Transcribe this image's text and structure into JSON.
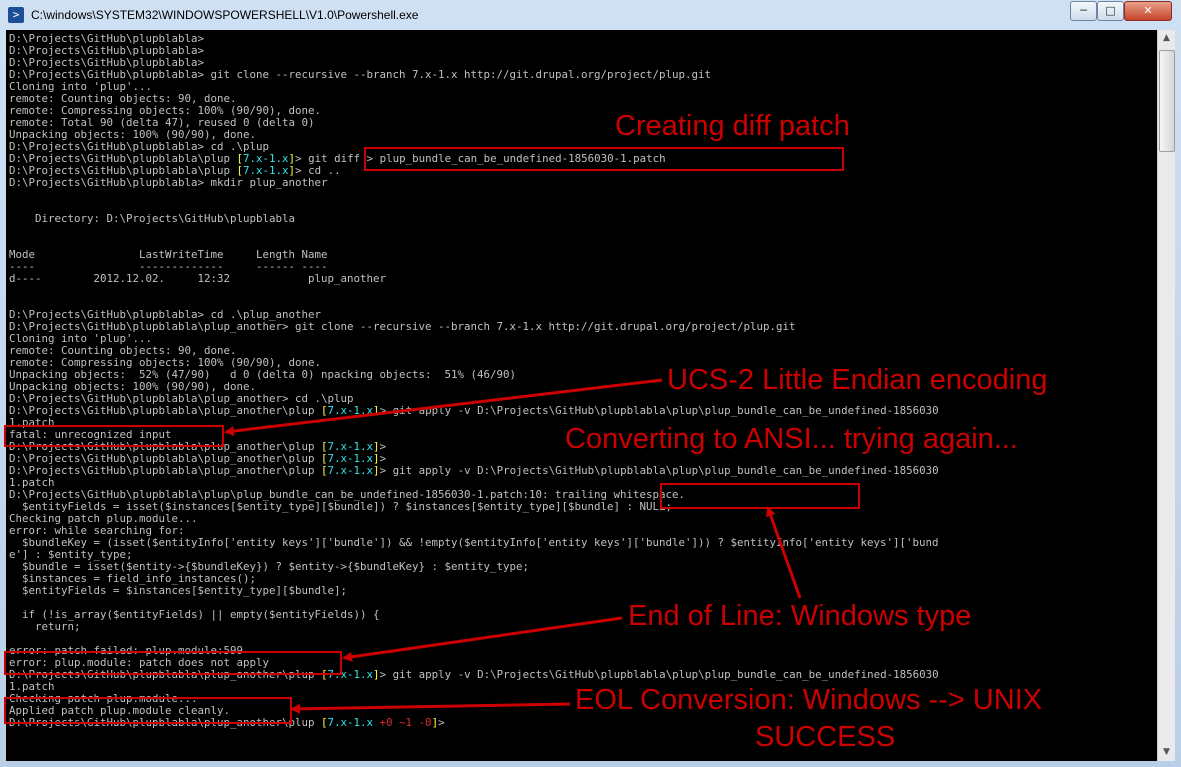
{
  "window": {
    "title": "C:\\windows\\SYSTEM32\\WINDOWSPOWERSHELL\\V1.0\\Powershell.exe",
    "minimize_label": "─",
    "maximize_label": "□",
    "close_label": "✕"
  },
  "console": {
    "lines": [
      [
        {
          "t": "D:\\Projects\\GitHub\\plupblabla>"
        }
      ],
      [
        {
          "t": "D:\\Projects\\GitHub\\plupblabla>"
        }
      ],
      [
        {
          "t": "D:\\Projects\\GitHub\\plupblabla>"
        }
      ],
      [
        {
          "t": "D:\\Projects\\GitHub\\plupblabla> git clone --recursive --branch 7.x-1.x http://git.drupal.org/project/plup.git"
        }
      ],
      [
        {
          "t": "Cloning into 'plup'..."
        }
      ],
      [
        {
          "t": "remote: Counting objects: 90, done."
        }
      ],
      [
        {
          "t": "remote: Compressing objects: 100% (90/90), done."
        }
      ],
      [
        {
          "t": "remote: Total 90 (delta 47), reused 0 (delta 0)"
        }
      ],
      [
        {
          "t": "Unpacking objects: 100% (90/90), done."
        }
      ],
      [
        {
          "t": "D:\\Projects\\GitHub\\plupblabla> cd .\\plup"
        }
      ],
      [
        {
          "t": "D:\\Projects\\GitHub\\plupblabla\\plup "
        },
        {
          "t": "[",
          "c": "y"
        },
        {
          "t": "7.x-1.x",
          "c": "c"
        },
        {
          "t": "]",
          "c": "y"
        },
        {
          "t": "> git diff > plup_bundle_can_be_undefined-1856030-1.patch"
        }
      ],
      [
        {
          "t": "D:\\Projects\\GitHub\\plupblabla\\plup "
        },
        {
          "t": "[",
          "c": "y"
        },
        {
          "t": "7.x-1.x",
          "c": "c"
        },
        {
          "t": "]",
          "c": "y"
        },
        {
          "t": "> cd .."
        }
      ],
      [
        {
          "t": "D:\\Projects\\GitHub\\plupblabla> mkdir plup_another"
        }
      ],
      [
        {
          "t": ""
        }
      ],
      [
        {
          "t": ""
        }
      ],
      [
        {
          "t": "    Directory: D:\\Projects\\GitHub\\plupblabla"
        }
      ],
      [
        {
          "t": ""
        }
      ],
      [
        {
          "t": ""
        }
      ],
      [
        {
          "t": "Mode                LastWriteTime     Length Name"
        }
      ],
      [
        {
          "t": "----                -------------     ------ ----"
        }
      ],
      [
        {
          "t": "d----        2012.12.02.     12:32            plup_another"
        }
      ],
      [
        {
          "t": ""
        }
      ],
      [
        {
          "t": ""
        }
      ],
      [
        {
          "t": "D:\\Projects\\GitHub\\plupblabla> cd .\\plup_another"
        }
      ],
      [
        {
          "t": "D:\\Projects\\GitHub\\plupblabla\\plup_another> git clone --recursive --branch 7.x-1.x http://git.drupal.org/project/plup.git"
        }
      ],
      [
        {
          "t": "Cloning into 'plup'..."
        }
      ],
      [
        {
          "t": "remote: Counting objects: 90, done."
        }
      ],
      [
        {
          "t": "remote: Compressing objects: 100% (90/90), done."
        }
      ],
      [
        {
          "t": "Unpacking objects:  52% (47/90)   d 0 (delta 0) npacking objects:  51% (46/90)"
        }
      ],
      [
        {
          "t": "Unpacking objects: 100% (90/90), done."
        }
      ],
      [
        {
          "t": "D:\\Projects\\GitHub\\plupblabla\\plup_another> cd .\\plup"
        }
      ],
      [
        {
          "t": "D:\\Projects\\GitHub\\plupblabla\\plup_another\\plup "
        },
        {
          "t": "[",
          "c": "y"
        },
        {
          "t": "7.x-1.x",
          "c": "c"
        },
        {
          "t": "]",
          "c": "y"
        },
        {
          "t": "> git apply -v D:\\Projects\\GitHub\\plupblabla\\plup\\plup_bundle_can_be_undefined-1856030"
        }
      ],
      [
        {
          "t": "1.patch"
        }
      ],
      [
        {
          "t": "fatal: unrecognized input"
        }
      ],
      [
        {
          "t": "D:\\Projects\\GitHub\\plupblabla\\plup_another\\plup "
        },
        {
          "t": "[",
          "c": "y"
        },
        {
          "t": "7.x-1.x",
          "c": "c"
        },
        {
          "t": "]",
          "c": "y"
        },
        {
          "t": ">"
        }
      ],
      [
        {
          "t": "D:\\Projects\\GitHub\\plupblabla\\plup_another\\plup "
        },
        {
          "t": "[",
          "c": "y"
        },
        {
          "t": "7.x-1.x",
          "c": "c"
        },
        {
          "t": "]",
          "c": "y"
        },
        {
          "t": ">"
        }
      ],
      [
        {
          "t": "D:\\Projects\\GitHub\\plupblabla\\plup_another\\plup "
        },
        {
          "t": "[",
          "c": "y"
        },
        {
          "t": "7.x-1.x",
          "c": "c"
        },
        {
          "t": "]",
          "c": "y"
        },
        {
          "t": "> git apply -v D:\\Projects\\GitHub\\plupblabla\\plup\\plup_bundle_can_be_undefined-1856030"
        }
      ],
      [
        {
          "t": "1.patch"
        }
      ],
      [
        {
          "t": "D:\\Projects\\GitHub\\plupblabla\\plup\\plup_bundle_can_be_undefined-1856030-1.patch:10: trailing whitespace."
        }
      ],
      [
        {
          "t": "  $entityFields = isset($instances[$entity_type][$bundle]) ? $instances[$entity_type][$bundle] : NULL;"
        }
      ],
      [
        {
          "t": "Checking patch plup.module..."
        }
      ],
      [
        {
          "t": "error: while searching for:"
        }
      ],
      [
        {
          "t": "  $bundleKey = (isset($entityInfo['entity keys']['bundle']) && !empty($entityInfo['entity keys']['bundle'])) ? $entityInfo['entity keys']['bund"
        }
      ],
      [
        {
          "t": "e'] : $entity_type;"
        }
      ],
      [
        {
          "t": "  $bundle = isset($entity->{$bundleKey}) ? $entity->{$bundleKey} : $entity_type;"
        }
      ],
      [
        {
          "t": "  $instances = field_info_instances();"
        }
      ],
      [
        {
          "t": "  $entityFields = $instances[$entity_type][$bundle];"
        }
      ],
      [
        {
          "t": ""
        }
      ],
      [
        {
          "t": "  if (!is_array($entityFields) || empty($entityFields)) {"
        }
      ],
      [
        {
          "t": "    return;"
        }
      ],
      [
        {
          "t": ""
        }
      ],
      [
        {
          "t": "error: patch failed: plup.module:599"
        }
      ],
      [
        {
          "t": "error: plup.module: patch does not apply"
        }
      ],
      [
        {
          "t": "D:\\Projects\\GitHub\\plupblabla\\plup_another\\plup "
        },
        {
          "t": "[",
          "c": "y"
        },
        {
          "t": "7.x-1.x",
          "c": "c"
        },
        {
          "t": "]",
          "c": "y"
        },
        {
          "t": "> git apply -v D:\\Projects\\GitHub\\plupblabla\\plup\\plup_bundle_can_be_undefined-1856030"
        }
      ],
      [
        {
          "t": "1.patch"
        }
      ],
      [
        {
          "t": "Checking patch plup.module..."
        }
      ],
      [
        {
          "t": "Applied patch plup.module cleanly."
        }
      ],
      [
        {
          "t": "D:\\Projects\\GitHub\\plupblabla\\plup_another\\plup "
        },
        {
          "t": "[",
          "c": "y"
        },
        {
          "t": "7.x-1.x",
          "c": "c"
        },
        {
          "t": " +0 ~1 -0",
          "c": "r"
        },
        {
          "t": "]",
          "c": "y"
        },
        {
          "t": ">"
        }
      ]
    ]
  },
  "annotations": {
    "creating_diff": "Creating diff patch",
    "ucs2": "UCS-2 Little Endian encoding",
    "converting": "Converting to ANSI... trying again...",
    "eol_windows": "End of Line: Windows type",
    "eol_conversion": "EOL Conversion: Windows --> UNIX",
    "success": "SUCCESS"
  },
  "colors": {
    "annotation": "#c00000",
    "prompt_bracket": "#ffff3c",
    "branch": "#2ee6e6",
    "status": "#d83030"
  }
}
